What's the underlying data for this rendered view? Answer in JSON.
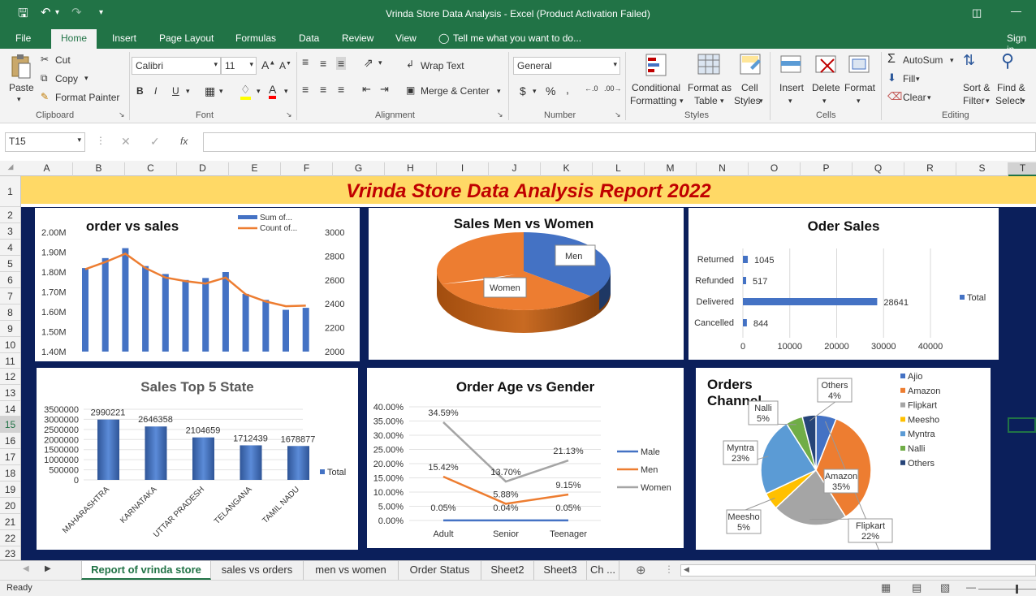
{
  "window": {
    "title": "Vrinda Store Data Analysis  -  Excel (Product Activation Failed)"
  },
  "tabs": {
    "file": "File",
    "home": "Home",
    "insert": "Insert",
    "page_layout": "Page Layout",
    "formulas": "Formulas",
    "data": "Data",
    "review": "Review",
    "view": "View",
    "tell": "Tell me what you want to do...",
    "signin": "Sign in"
  },
  "clipboard": {
    "paste": "Paste",
    "cut": "Cut",
    "copy": "Copy",
    "format_painter": "Format Painter",
    "label": "Clipboard"
  },
  "font": {
    "name": "Calibri",
    "size": "11",
    "label": "Font",
    "bold": "B",
    "italic": "I",
    "underline": "U"
  },
  "alignment": {
    "wrap": "Wrap Text",
    "merge": "Merge & Center",
    "label": "Alignment"
  },
  "number": {
    "format": "General",
    "label": "Number",
    "currency": "$",
    "percent": "%",
    "comma": ","
  },
  "styles": {
    "cond1": "Conditional",
    "cond2": "Formatting",
    "fmt1": "Format as",
    "fmt2": "Table",
    "cell1": "Cell",
    "cell2": "Styles",
    "label": "Styles"
  },
  "cells": {
    "insert": "Insert",
    "delete": "Delete",
    "format": "Format",
    "label": "Cells"
  },
  "editing": {
    "autosum": "AutoSum",
    "fill": "Fill",
    "clear": "Clear",
    "sort1": "Sort &",
    "sort2": "Filter",
    "find1": "Find &",
    "find2": "Select",
    "label": "Editing"
  },
  "formula_bar": {
    "namebox": "T15",
    "fx": "fx",
    "value": ""
  },
  "columns": [
    "A",
    "B",
    "C",
    "D",
    "E",
    "F",
    "G",
    "H",
    "I",
    "J",
    "K",
    "L",
    "M",
    "N",
    "O",
    "P",
    "Q",
    "R",
    "S",
    "T"
  ],
  "rows": [
    "1",
    "2",
    "3",
    "4",
    "5",
    "6",
    "7",
    "8",
    "9",
    "10",
    "11",
    "12",
    "13",
    "14",
    "15",
    "16",
    "17",
    "18",
    "19",
    "20",
    "21",
    "22",
    "23"
  ],
  "banner": "Vrinda Store Data Analysis Report 2022",
  "colors": {
    "excel_green": "#217346",
    "navy": "#0b1f5b",
    "banner": "#ffd966",
    "title_red": "#c00000",
    "blue": "#4472c4",
    "orange": "#ed7d31",
    "gray": "#a5a5a5",
    "yellow": "#ffc000",
    "lightblue": "#5b9bd5",
    "green": "#70ad47",
    "darkblue": "#264478"
  },
  "chart_data": [
    {
      "type": "bar",
      "title": "order vs sales",
      "series": [
        {
          "name": "Sum of...",
          "axis": "left",
          "values": [
            1.82,
            1.87,
            1.92,
            1.83,
            1.79,
            1.76,
            1.77,
            1.8,
            1.69,
            1.66,
            1.61,
            1.62
          ]
        },
        {
          "name": "Count of...",
          "axis": "right",
          "type": "line",
          "values": [
            2690,
            2750,
            2820,
            2700,
            2620,
            2590,
            2570,
            2620,
            2480,
            2420,
            2380,
            2385
          ]
        }
      ],
      "ylim_left": [
        1.4,
        2.0
      ],
      "yticks_left": [
        "2.00M",
        "1.90M",
        "1.80M",
        "1.70M",
        "1.60M",
        "1.50M",
        "1.40M"
      ],
      "ylim_right": [
        2000,
        3000
      ],
      "yticks_right": [
        "3000",
        "2800",
        "2600",
        "2400",
        "2200",
        "2000"
      ]
    },
    {
      "type": "pie",
      "title": "Sales Men vs Women",
      "labels": [
        "Men",
        "Women"
      ],
      "values": [
        36,
        64
      ]
    },
    {
      "type": "bar",
      "title": "Oder Sales",
      "orientation": "horizontal",
      "categories": [
        "Returned",
        "Refunded",
        "Delivered",
        "Cancelled"
      ],
      "values": [
        1045,
        517,
        28641,
        844
      ],
      "xticks": [
        "0",
        "10000",
        "20000",
        "30000",
        "40000"
      ],
      "xlim": [
        0,
        40000
      ],
      "legend": "Total"
    },
    {
      "type": "bar",
      "title": "Sales Top 5 State",
      "categories": [
        "MAHARASHTRA",
        "KARNATAKA",
        "UTTAR PRADESH",
        "TELANGANA",
        "TAMIL NADU"
      ],
      "values": [
        2990221,
        2646358,
        2104659,
        1712439,
        1678877
      ],
      "ylim": [
        0,
        3500000
      ],
      "yticks": [
        "3500000",
        "3000000",
        "2500000",
        "2000000",
        "1500000",
        "1000000",
        "500000",
        "0"
      ],
      "legend": "Total"
    },
    {
      "type": "line",
      "title": "Order Age vs Gender",
      "categories": [
        "Adult",
        "Senior",
        "Teenager"
      ],
      "series": [
        {
          "name": "Male",
          "values": [
            0.05,
            0.04,
            0.05
          ],
          "labels": [
            "0.05%",
            "0.04%",
            "0.05%"
          ]
        },
        {
          "name": "Men",
          "values": [
            15.42,
            5.88,
            9.15
          ],
          "labels": [
            "15.42%",
            "5.88%",
            "9.15%"
          ]
        },
        {
          "name": "Women",
          "values": [
            34.59,
            13.7,
            21.13
          ],
          "labels": [
            "34.59%",
            "13.70%",
            "21.13%"
          ]
        }
      ],
      "ylim": [
        0,
        40
      ],
      "yticks": [
        "40.00%",
        "35.00%",
        "30.00%",
        "25.00%",
        "20.00%",
        "15.00%",
        "10.00%",
        "5.00%",
        "0.00%"
      ]
    },
    {
      "type": "pie",
      "title": "Orders Channel",
      "labels": [
        "Ajio",
        "Amazon",
        "Flipkart",
        "Meesho",
        "Myntra",
        "Nalli",
        "Others"
      ],
      "values": [
        6,
        35,
        22,
        5,
        23,
        5,
        4
      ],
      "pct_labels": [
        "6%",
        "35%",
        "22%",
        "5%",
        "23%",
        "5%",
        "4%"
      ]
    }
  ],
  "sheets": [
    "Report of vrinda store",
    "sales vs orders",
    "men vs women",
    "Order Status",
    "Sheet2",
    "Sheet3",
    "Ch ..."
  ],
  "status": {
    "ready": "Ready"
  }
}
